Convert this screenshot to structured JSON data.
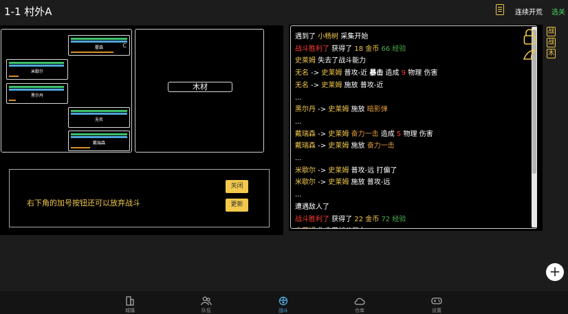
{
  "header": {
    "title": "1-1 村外A",
    "continuous_label": "连续开荒",
    "select_label": "选关"
  },
  "battle": {
    "units": [
      {
        "name": "霍森",
        "mark": "C"
      },
      {
        "name": "米歇尔",
        "mark": ""
      },
      {
        "name": "黑尔丹",
        "mark": ""
      },
      {
        "name": "无名",
        "mark": ""
      },
      {
        "name": "戴瑞森",
        "mark": ""
      }
    ],
    "resource_button": "木材"
  },
  "notice": {
    "text": "右下角的加号按钮还可以放弃战斗",
    "close_label": "关闭",
    "refresh_label": "更新"
  },
  "log": [
    [
      [
        "w",
        "遇到了 "
      ],
      [
        "y",
        "小杨树"
      ],
      [
        "w",
        " 采集开始"
      ]
    ],
    [
      [
        "r",
        "战斗胜利了"
      ],
      [
        "w",
        " 获得了 "
      ],
      [
        "y",
        "18 金币"
      ],
      [
        "g",
        " 66 经验"
      ]
    ],
    [
      [
        "y",
        "史莱姆"
      ],
      [
        "w",
        " 失去了战斗能力"
      ]
    ],
    [
      [
        "y",
        "无名"
      ],
      [
        "w",
        " -> "
      ],
      [
        "y",
        "史莱姆"
      ],
      [
        "w",
        " 普攻-近 "
      ],
      [
        "b",
        "暴击"
      ],
      [
        "w",
        " 造成 "
      ],
      [
        "r",
        "9"
      ],
      [
        "w",
        " 物理 伤害"
      ]
    ],
    [
      [
        "y",
        "无名"
      ],
      [
        "w",
        " -> "
      ],
      [
        "y",
        "史莱姆"
      ],
      [
        "w",
        " 施放 普攻-近"
      ]
    ],
    [
      [
        "w",
        "..."
      ]
    ],
    [
      [
        "y",
        "黑尔丹"
      ],
      [
        "w",
        " -> "
      ],
      [
        "y",
        "史莱姆"
      ],
      [
        "w",
        " 施放 "
      ],
      [
        "o",
        "暗影弹"
      ]
    ],
    [
      [
        "w",
        "..."
      ]
    ],
    [
      [
        "y",
        "戴瑞森"
      ],
      [
        "w",
        " -> "
      ],
      [
        "y",
        "史莱姆"
      ],
      [
        "w",
        " "
      ],
      [
        "o",
        "奋力一击"
      ],
      [
        "w",
        " 造成 "
      ],
      [
        "r",
        "5"
      ],
      [
        "w",
        " 物理 伤害"
      ]
    ],
    [
      [
        "y",
        "戴瑞森"
      ],
      [
        "w",
        " -> "
      ],
      [
        "y",
        "史莱姆"
      ],
      [
        "w",
        " 施放 "
      ],
      [
        "o",
        "奋力一击"
      ]
    ],
    [
      [
        "w",
        "..."
      ]
    ],
    [
      [
        "y",
        "米歇尔"
      ],
      [
        "w",
        " -> "
      ],
      [
        "y",
        "史莱姆"
      ],
      [
        "w",
        " 普攻-远 打偏了"
      ]
    ],
    [
      [
        "y",
        "米歇尔"
      ],
      [
        "w",
        " -> "
      ],
      [
        "y",
        "史莱姆"
      ],
      [
        "w",
        " 施放 普攻-远"
      ]
    ],
    [
      [
        "w",
        "..."
      ]
    ],
    [
      [
        "w",
        "遭遇敌人了"
      ]
    ],
    [
      [
        "r",
        "战斗胜利了"
      ],
      [
        "w",
        " 获得了 "
      ],
      [
        "y",
        "22 金币"
      ],
      [
        "g",
        " 72 经验"
      ]
    ],
    [
      [
        "y",
        "史莱姆"
      ],
      [
        "w",
        " 失去了战斗能力"
      ]
    ]
  ],
  "side_tags": [
    "战",
    "战",
    "木"
  ],
  "plus_label": "+",
  "nav": [
    {
      "label": "城镇",
      "icon": "building-icon"
    },
    {
      "label": "队伍",
      "icon": "team-icon"
    },
    {
      "label": "战斗",
      "icon": "battle-icon",
      "active": true
    },
    {
      "label": "仓库",
      "icon": "cloud-icon"
    },
    {
      "label": "设置",
      "icon": "gamepad-icon"
    }
  ],
  "colors": {
    "accent": "#f2c94c",
    "select": "#4cd964",
    "active_nav": "#4fa8dc",
    "victory": "#ff3b30",
    "exp": "#4caf50"
  }
}
